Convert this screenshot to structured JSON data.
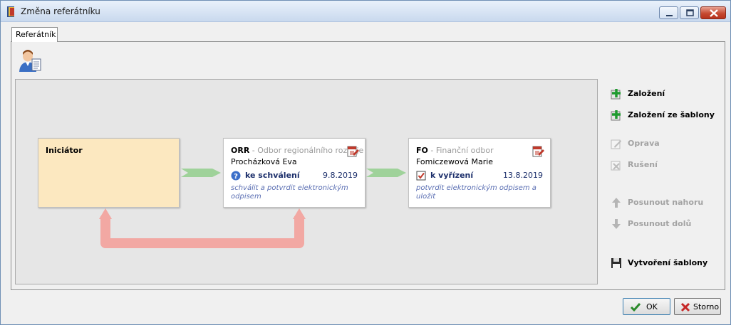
{
  "window": {
    "title": "Změna referátníku"
  },
  "tabs": [
    {
      "label": "Referátník",
      "active": true
    }
  ],
  "workflow": {
    "nodes": [
      {
        "code": "Iniciátor",
        "department": "",
        "person": "",
        "state": "",
        "date": "",
        "note": ""
      },
      {
        "code": "ORR",
        "department": " - Odbor regionálního rozvoje",
        "person": "Procházková Eva",
        "state": "ke schválení",
        "date": "9.8.2019",
        "note": "schválit a potvrdit elektronickým odpisem",
        "state_icon": "question-icon"
      },
      {
        "code": "FO",
        "department": " - Finanční odbor",
        "person": "Fomiczewová Marie",
        "state": "k vyřízení",
        "date": "13.8.2019",
        "note": "potvrdit elektronickým odpisem a uložit",
        "state_icon": "checkbox-checked-icon"
      }
    ],
    "colors": {
      "forward_arrow": "#9fd29a",
      "return_arrow": "#f2a8a3",
      "initiator_bg": "#fce8c0"
    }
  },
  "side_actions": [
    {
      "label": "Založení",
      "enabled": true,
      "icon": "plus-icon"
    },
    {
      "label": "Založení ze šablony",
      "enabled": true,
      "icon": "plus-icon"
    },
    {
      "label": "Oprava",
      "enabled": false,
      "icon": "edit-icon"
    },
    {
      "label": "Rušení",
      "enabled": false,
      "icon": "delete-icon"
    },
    {
      "label": "Posunout nahoru",
      "enabled": false,
      "icon": "arrow-up-icon"
    },
    {
      "label": "Posunout dolů",
      "enabled": false,
      "icon": "arrow-down-icon"
    },
    {
      "label": "Vytvoření šablony",
      "enabled": true,
      "icon": "floppy-icon"
    }
  ],
  "footer": {
    "ok_label": "OK",
    "cancel_label": "Storno"
  }
}
